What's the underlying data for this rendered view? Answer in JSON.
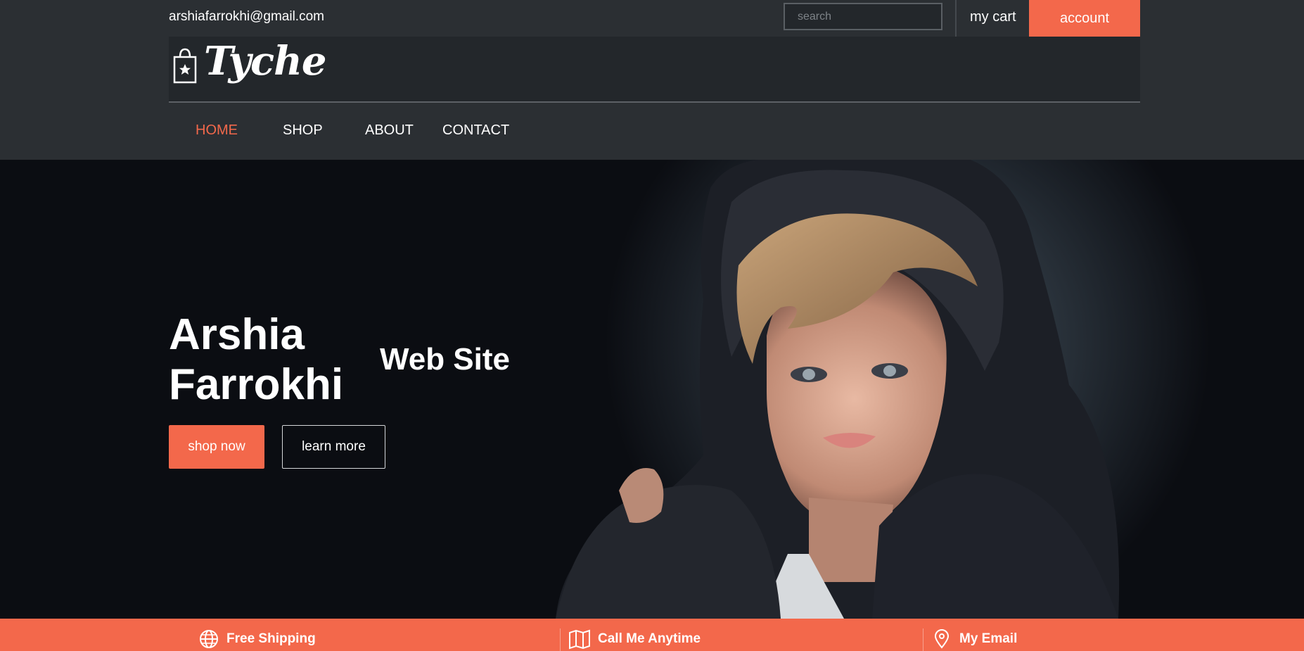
{
  "topbar": {
    "email": "arshiafarrokhi@gmail.com",
    "search_placeholder": "search",
    "cart_label": "my cart",
    "account_label": "account"
  },
  "brand": {
    "name": "Tyche",
    "logo_icon": "shopping-bag-star-icon"
  },
  "nav": {
    "items": [
      {
        "label": "HOME",
        "active": true
      },
      {
        "label": "SHOP",
        "active": false
      },
      {
        "label": "ABOUT",
        "active": false
      },
      {
        "label": "CONTACT",
        "active": false
      }
    ]
  },
  "hero": {
    "title_line1": "Arshia",
    "title_line2": "Farrokhi",
    "subtitle": "Web Site",
    "primary_button": "shop now",
    "secondary_button": "learn more"
  },
  "features": [
    {
      "label": "Free Shipping",
      "icon": "globe-icon"
    },
    {
      "label": "Call Me Anytime",
      "icon": "map-icon"
    },
    {
      "label": "My Email",
      "icon": "location-pin-icon"
    }
  ],
  "colors": {
    "accent": "#f3684b",
    "header_bg": "#2b2f33",
    "logo_bg": "#23272b",
    "hero_bg": "#0b0d12"
  }
}
